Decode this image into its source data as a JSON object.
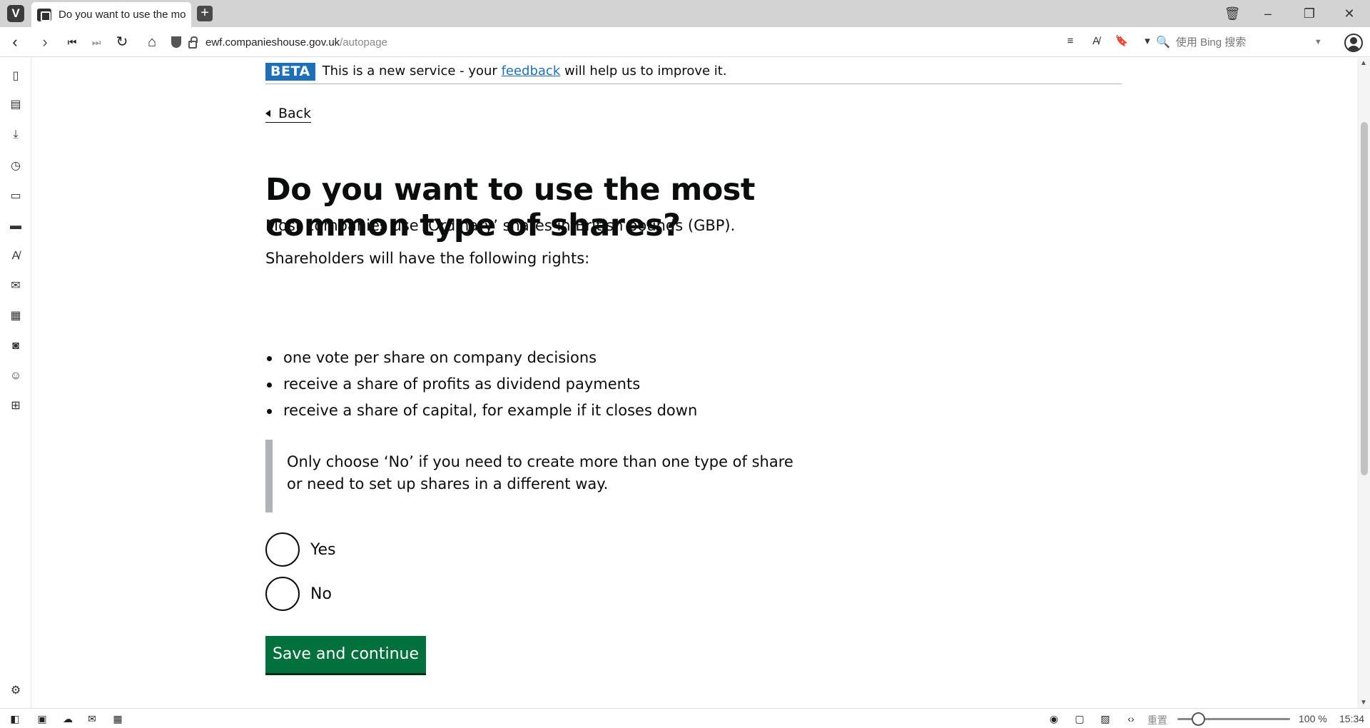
{
  "browser": {
    "tab_title": "Do you want to use the mo",
    "url_domain": "ewf.companieshouse.gov.uk",
    "url_path": "/autopage",
    "search_placeholder": "使用 Bing 搜索"
  },
  "statusbar": {
    "reset_label": "重置",
    "zoom_level": "100 %",
    "clock": "15:34"
  },
  "page": {
    "phase_tag": "BETA",
    "phase_text_before": "This is a new service - your ",
    "phase_link": "feedback",
    "phase_text_after": " will help us to improve it.",
    "back_label": "Back",
    "title": "Do you want to use the most common type of shares?",
    "intro": "Most companies use ‘Ordinary’ shares in British pounds (GBP).",
    "rights_intro": "Shareholders will have the following rights:",
    "rights": [
      "one vote per share on company decisions",
      "receive a share of profits as dividend payments",
      "receive a share of capital, for example if it closes down"
    ],
    "inset_text": "Only choose ‘No’ if you need to create more than one type of share or need to set up shares in a different way.",
    "options": [
      {
        "label": "Yes",
        "selected": false
      },
      {
        "label": "No",
        "selected": false
      }
    ],
    "submit_label": "Save and continue"
  },
  "colors": {
    "beta_tag": "#1d70b8",
    "link": "#1d70b8",
    "button": "#00703c",
    "text": "#0b0c0c"
  }
}
